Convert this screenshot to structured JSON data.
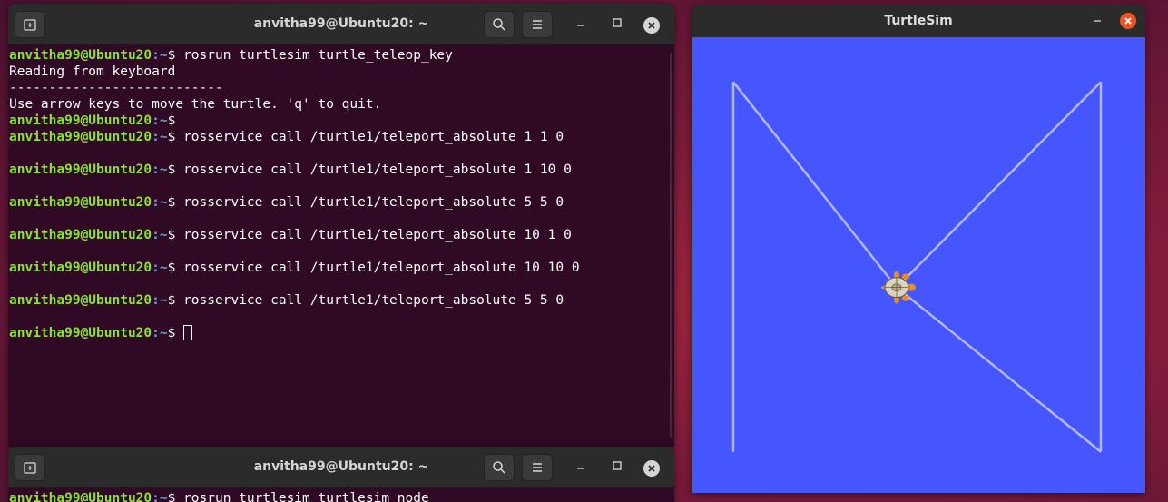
{
  "terminal_top": {
    "title": "anvitha99@Ubuntu20: ~",
    "icons": {
      "new_tab": "new-tab-icon",
      "search": "search-icon",
      "menu": "hamburger-menu-icon",
      "minimize": "minimize-icon",
      "maximize": "maximize-icon",
      "close": "close-icon"
    },
    "prompt_user": "anvitha99@Ubuntu20",
    "prompt_path": ":~",
    "prompt_symbol": "$ ",
    "lines": [
      {
        "type": "prompt",
        "cmd": "rosrun turtlesim turtle_teleop_key"
      },
      {
        "type": "output",
        "text": "Reading from keyboard"
      },
      {
        "type": "output",
        "text": "---------------------------"
      },
      {
        "type": "output",
        "text": "Use arrow keys to move the turtle. 'q' to quit."
      },
      {
        "type": "prompt",
        "cmd": ""
      },
      {
        "type": "prompt",
        "cmd": "rosservice call /turtle1/teleport_absolute 1 1 0"
      },
      {
        "type": "output",
        "text": ""
      },
      {
        "type": "prompt",
        "cmd": "rosservice call /turtle1/teleport_absolute 1 10 0"
      },
      {
        "type": "output",
        "text": ""
      },
      {
        "type": "prompt",
        "cmd": "rosservice call /turtle1/teleport_absolute 5 5 0"
      },
      {
        "type": "output",
        "text": ""
      },
      {
        "type": "prompt",
        "cmd": "rosservice call /turtle1/teleport_absolute 10 1 0"
      },
      {
        "type": "output",
        "text": ""
      },
      {
        "type": "prompt",
        "cmd": "rosservice call /turtle1/teleport_absolute 10 10 0"
      },
      {
        "type": "output",
        "text": ""
      },
      {
        "type": "prompt",
        "cmd": "rosservice call /turtle1/teleport_absolute 5 5 0"
      },
      {
        "type": "output",
        "text": ""
      },
      {
        "type": "prompt",
        "cmd": "",
        "cursor": true
      }
    ]
  },
  "terminal_bottom": {
    "title": "anvitha99@Ubuntu20: ~",
    "prompt_user": "anvitha99@Ubuntu20",
    "prompt_path": ":~",
    "prompt_symbol": "$ ",
    "lines": [
      {
        "type": "prompt",
        "cmd": "rosrun turtlesim turtlesim_node"
      }
    ]
  },
  "turtlesim": {
    "title": "TurtleSim",
    "background_color": "#4556ff",
    "path_color": "#b3b8ff",
    "icons": {
      "minimize": "minimize-icon",
      "close": "close-icon"
    },
    "world_size": [
      11.0888,
      11.0888
    ],
    "path_points": [
      [
        1,
        1
      ],
      [
        1,
        10
      ],
      [
        5,
        5
      ],
      [
        10,
        1
      ],
      [
        10,
        10
      ],
      [
        5,
        5
      ]
    ],
    "turtle": {
      "x": 5,
      "y": 5,
      "theta": 0
    }
  }
}
